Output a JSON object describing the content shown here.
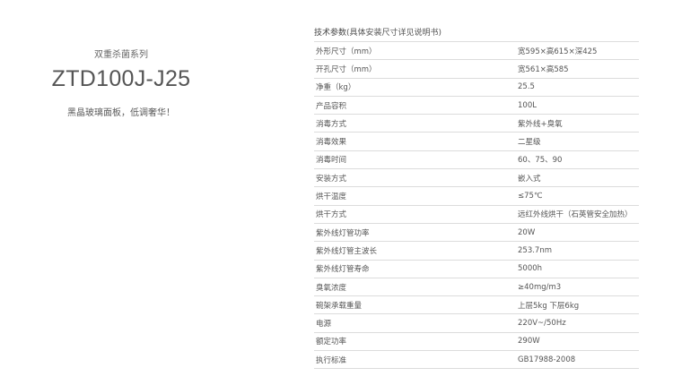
{
  "product": {
    "series": "双重杀菌系列",
    "model": "ZTD100J-J25",
    "slogan": "黑晶玻璃面板，低调奢华！"
  },
  "specs": {
    "heading": "技术参数",
    "heading_note": "(具体安装尺寸详见说明书)",
    "rows": [
      {
        "label": "外形尺寸（mm）",
        "value": "宽595×高615×深425"
      },
      {
        "label": "开孔尺寸（mm）",
        "value": "宽561×高585"
      },
      {
        "label": "净重（kg）",
        "value": "25.5"
      },
      {
        "label": "产品容积",
        "value": "100L"
      },
      {
        "label": "消毒方式",
        "value": "紫外线+臭氧"
      },
      {
        "label": "消毒效果",
        "value": "二星级"
      },
      {
        "label": "消毒时间",
        "value": "60、75、90"
      },
      {
        "label": "安装方式",
        "value": "嵌入式"
      },
      {
        "label": "烘干温度",
        "value": "≤75℃"
      },
      {
        "label": "烘干方式",
        "value": "远红外线烘干（石英管安全加热）"
      },
      {
        "label": "紫外线灯管功率",
        "value": "20W"
      },
      {
        "label": "紫外线灯管主波长",
        "value": "253.7nm"
      },
      {
        "label": "紫外线灯管寿命",
        "value": "5000h"
      },
      {
        "label": "臭氧浓度",
        "value": "≥40mg/m3"
      },
      {
        "label": "碗架承载重量",
        "value": "上层5kg 下层6kg"
      },
      {
        "label": "电源",
        "value": "220V~/50Hz"
      },
      {
        "label": "额定功率",
        "value": "290W"
      },
      {
        "label": "执行标准",
        "value": "GB17988-2008"
      }
    ]
  }
}
